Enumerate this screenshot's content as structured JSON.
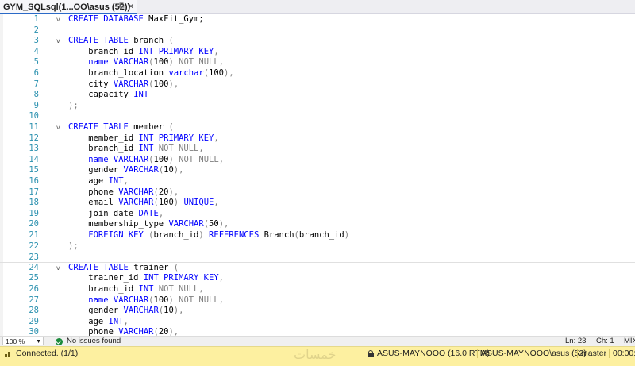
{
  "tab": {
    "title": "GYM_SQLsql(1...OO\\asus (52))",
    "pin_icon": "pin-icon",
    "close_label": "×"
  },
  "editor": {
    "lines": [
      {
        "n": "1",
        "fold": "v",
        "segs": [
          [
            "kw",
            "CREATE DATABASE "
          ],
          [
            "",
            "MaxFit_Gym;"
          ]
        ]
      },
      {
        "n": "2",
        "fold": "",
        "segs": []
      },
      {
        "n": "3",
        "fold": "v",
        "segs": [
          [
            "kw",
            "CREATE TABLE "
          ],
          [
            "",
            "branch "
          ],
          [
            "gr",
            "("
          ]
        ]
      },
      {
        "n": "4",
        "fold": "",
        "segs": [
          [
            "",
            "    branch_id "
          ],
          [
            "kw",
            "INT PRIMARY KEY"
          ],
          [
            "gr",
            ","
          ]
        ]
      },
      {
        "n": "5",
        "fold": "",
        "segs": [
          [
            "kw",
            "    name "
          ],
          [
            "kw",
            "VARCHAR"
          ],
          [
            "gr",
            "("
          ],
          [
            "",
            "100"
          ],
          [
            "gr",
            ")"
          ],
          [
            "gr",
            " NOT NULL,"
          ]
        ]
      },
      {
        "n": "6",
        "fold": "",
        "segs": [
          [
            "",
            "    branch_location "
          ],
          [
            "kw",
            "varchar"
          ],
          [
            "gr",
            "("
          ],
          [
            "",
            "100"
          ],
          [
            "gr",
            "),"
          ]
        ]
      },
      {
        "n": "7",
        "fold": "",
        "segs": [
          [
            "",
            "    city "
          ],
          [
            "kw",
            "VARCHAR"
          ],
          [
            "gr",
            "("
          ],
          [
            "",
            "100"
          ],
          [
            "gr",
            "),"
          ]
        ]
      },
      {
        "n": "8",
        "fold": "",
        "segs": [
          [
            "",
            "    capacity "
          ],
          [
            "kw",
            "INT"
          ]
        ]
      },
      {
        "n": "9",
        "fold": "",
        "segs": [
          [
            "gr",
            ");"
          ]
        ]
      },
      {
        "n": "10",
        "fold": "",
        "segs": []
      },
      {
        "n": "11",
        "fold": "v",
        "segs": [
          [
            "kw",
            "CREATE TABLE "
          ],
          [
            "",
            "member "
          ],
          [
            "gr",
            "("
          ]
        ]
      },
      {
        "n": "12",
        "fold": "",
        "segs": [
          [
            "",
            "    member_id "
          ],
          [
            "kw",
            "INT PRIMARY KEY"
          ],
          [
            "gr",
            ","
          ]
        ]
      },
      {
        "n": "13",
        "fold": "",
        "segs": [
          [
            "",
            "    branch_id "
          ],
          [
            "kw",
            "INT"
          ],
          [
            "gr",
            " NOT NULL,"
          ]
        ]
      },
      {
        "n": "14",
        "fold": "",
        "segs": [
          [
            "kw",
            "    name "
          ],
          [
            "kw",
            "VARCHAR"
          ],
          [
            "gr",
            "("
          ],
          [
            "",
            "100"
          ],
          [
            "gr",
            ")"
          ],
          [
            "gr",
            " NOT NULL,"
          ]
        ]
      },
      {
        "n": "15",
        "fold": "",
        "segs": [
          [
            "",
            "    gender "
          ],
          [
            "kw",
            "VARCHAR"
          ],
          [
            "gr",
            "("
          ],
          [
            "",
            "10"
          ],
          [
            "gr",
            "),"
          ]
        ]
      },
      {
        "n": "16",
        "fold": "",
        "segs": [
          [
            "",
            "    age "
          ],
          [
            "kw",
            "INT"
          ],
          [
            "gr",
            ","
          ]
        ]
      },
      {
        "n": "17",
        "fold": "",
        "segs": [
          [
            "",
            "    phone "
          ],
          [
            "kw",
            "VARCHAR"
          ],
          [
            "gr",
            "("
          ],
          [
            "",
            "20"
          ],
          [
            "gr",
            "),"
          ]
        ]
      },
      {
        "n": "18",
        "fold": "",
        "segs": [
          [
            "",
            "    email "
          ],
          [
            "kw",
            "VARCHAR"
          ],
          [
            "gr",
            "("
          ],
          [
            "",
            "100"
          ],
          [
            "gr",
            ") "
          ],
          [
            "kw",
            "UNIQUE"
          ],
          [
            "gr",
            ","
          ]
        ]
      },
      {
        "n": "19",
        "fold": "",
        "segs": [
          [
            "",
            "    join_date "
          ],
          [
            "kw",
            "DATE"
          ],
          [
            "gr",
            ","
          ]
        ]
      },
      {
        "n": "20",
        "fold": "",
        "segs": [
          [
            "",
            "    membership_type "
          ],
          [
            "kw",
            "VARCHAR"
          ],
          [
            "gr",
            "("
          ],
          [
            "",
            "50"
          ],
          [
            "gr",
            "),"
          ]
        ]
      },
      {
        "n": "21",
        "fold": "",
        "segs": [
          [
            "kw",
            "    FOREIGN KEY "
          ],
          [
            "gr",
            "("
          ],
          [
            "",
            "branch_id"
          ],
          [
            "gr",
            ") "
          ],
          [
            "kw",
            "REFERENCES "
          ],
          [
            "",
            "Branch"
          ],
          [
            "gr",
            "("
          ],
          [
            "",
            "branch_id"
          ],
          [
            "gr",
            ")"
          ]
        ]
      },
      {
        "n": "22",
        "fold": "",
        "segs": [
          [
            "gr",
            ");"
          ]
        ]
      },
      {
        "n": "23",
        "fold": "",
        "current": true,
        "segs": []
      },
      {
        "n": "24",
        "fold": "v",
        "segs": [
          [
            "kw",
            "CREATE TABLE "
          ],
          [
            "",
            "trainer "
          ],
          [
            "gr",
            "("
          ]
        ]
      },
      {
        "n": "25",
        "fold": "",
        "segs": [
          [
            "",
            "    trainer_id "
          ],
          [
            "kw",
            "INT PRIMARY KEY"
          ],
          [
            "gr",
            ","
          ]
        ]
      },
      {
        "n": "26",
        "fold": "",
        "segs": [
          [
            "",
            "    branch_id "
          ],
          [
            "kw",
            "INT"
          ],
          [
            "gr",
            " NOT NULL,"
          ]
        ]
      },
      {
        "n": "27",
        "fold": "",
        "segs": [
          [
            "kw",
            "    name "
          ],
          [
            "kw",
            "VARCHAR"
          ],
          [
            "gr",
            "("
          ],
          [
            "",
            "100"
          ],
          [
            "gr",
            ")"
          ],
          [
            "gr",
            " NOT NULL,"
          ]
        ]
      },
      {
        "n": "28",
        "fold": "",
        "segs": [
          [
            "",
            "    gender "
          ],
          [
            "kw",
            "VARCHAR"
          ],
          [
            "gr",
            "("
          ],
          [
            "",
            "10"
          ],
          [
            "gr",
            "),"
          ]
        ]
      },
      {
        "n": "29",
        "fold": "",
        "segs": [
          [
            "",
            "    age "
          ],
          [
            "kw",
            "INT"
          ],
          [
            "gr",
            ","
          ]
        ]
      },
      {
        "n": "30",
        "fold": "",
        "segs": [
          [
            "",
            "    phone "
          ],
          [
            "kw",
            "VARCHAR"
          ],
          [
            "gr",
            "("
          ],
          [
            "",
            "20"
          ],
          [
            "gr",
            "),"
          ]
        ]
      }
    ]
  },
  "editor_bar": {
    "zoom": "100 %",
    "issues": "No issues found",
    "ln": "Ln: 23",
    "ch": "Ch: 1",
    "mode": "MIX"
  },
  "status": {
    "connection": "Connected. (1/1)",
    "server": "ASUS-MAYNOOO (16.0 RTM)",
    "user": "ASUS-MAYNOOO\\asus (52)",
    "database": "master",
    "time": "00:00:0",
    "watermark": "خمسات"
  },
  "colors": {
    "keyword": "#0000ff",
    "gray": "#808080",
    "line_number": "#2b91af",
    "status_bar": "#fdf0a0"
  }
}
